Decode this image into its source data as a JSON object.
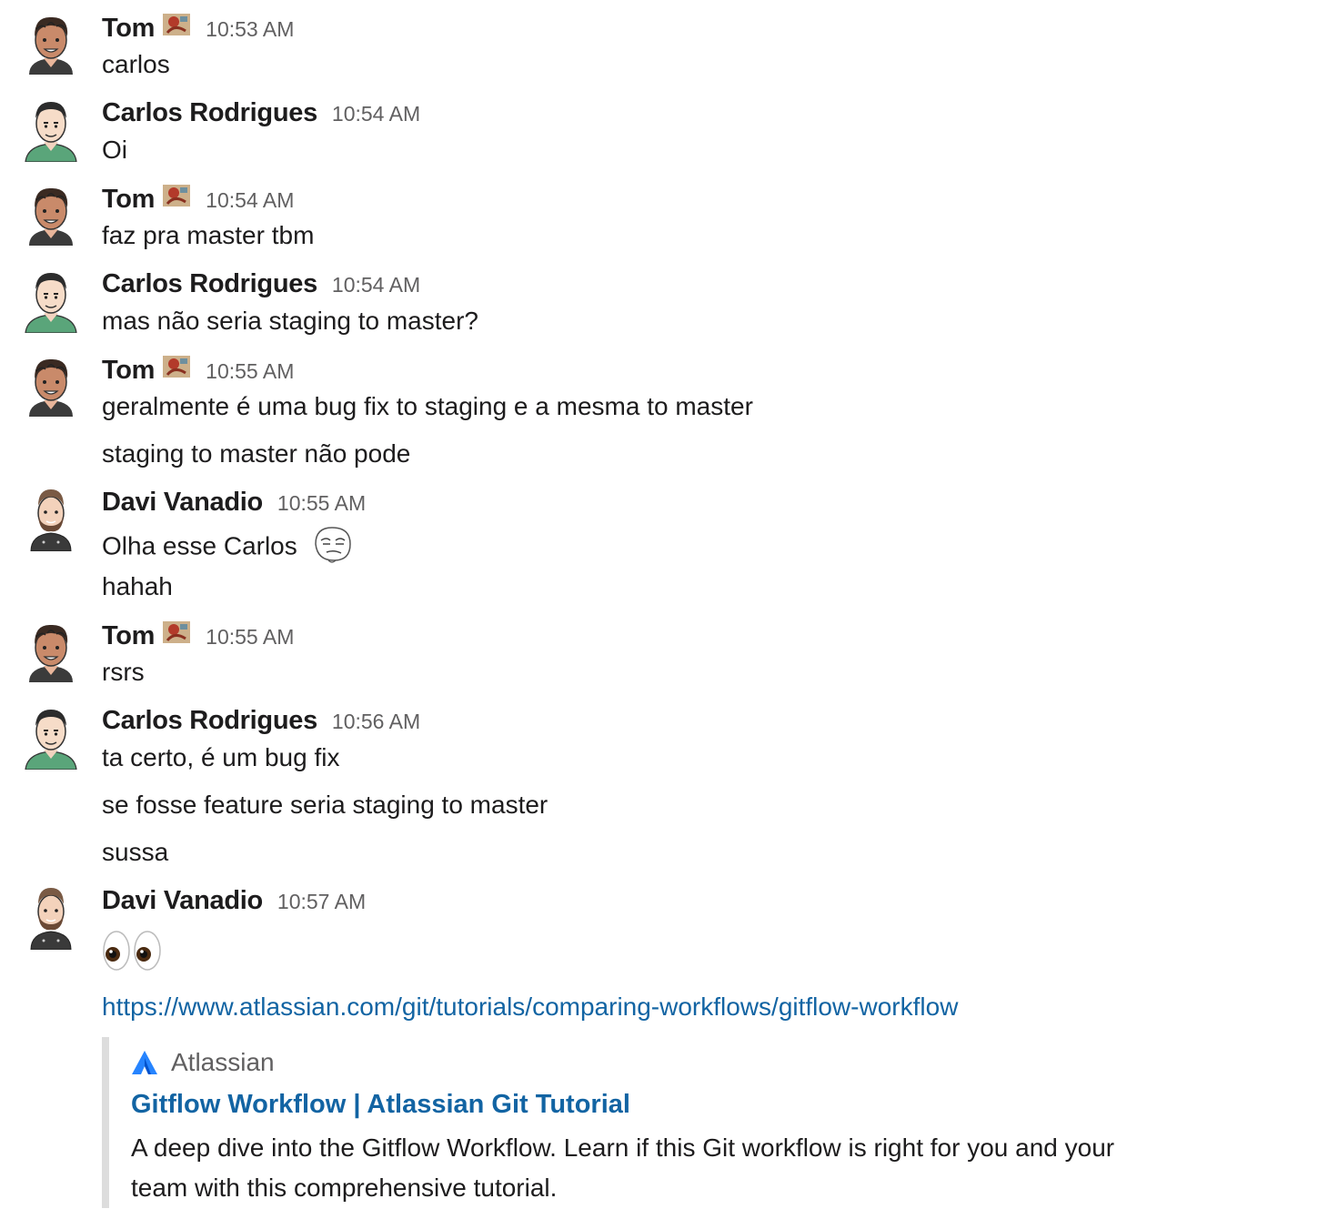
{
  "messages": [
    {
      "author": "Tom",
      "time": "10:53 AM",
      "lines": [
        "carlos"
      ]
    },
    {
      "author": "Carlos Rodrigues",
      "time": "10:54 AM",
      "lines": [
        "Oi"
      ]
    },
    {
      "author": "Tom",
      "time": "10:54 AM",
      "lines": [
        "faz pra master tbm"
      ]
    },
    {
      "author": "Carlos Rodrigues",
      "time": "10:54 AM",
      "lines": [
        "mas não seria staging to master?"
      ]
    },
    {
      "author": "Tom",
      "time": "10:55 AM",
      "lines": [
        "geralmente é uma bug fix to staging e a mesma to master",
        "staging to master não pode"
      ]
    },
    {
      "author": "Davi Vanadio",
      "time": "10:55 AM",
      "lines": [
        "Olha esse Carlos",
        "hahah"
      ]
    },
    {
      "author": "Tom",
      "time": "10:55 AM",
      "lines": [
        "rsrs"
      ]
    },
    {
      "author": "Carlos Rodrigues",
      "time": "10:56 AM",
      "lines": [
        "ta certo, é um bug fix",
        "se fosse feature seria staging to master",
        "sussa"
      ]
    },
    {
      "author": "Davi Vanadio",
      "time": "10:57 AM",
      "lines": [
        "👀"
      ]
    }
  ],
  "link": "https://www.atlassian.com/git/tutorials/comparing-workflows/gitflow-workflow",
  "unfurl": {
    "site": "Atlassian",
    "title": "Gitflow Workflow | Atlassian Git Tutorial",
    "description": "A deep dive into the Gitflow Workflow. Learn if this Git workflow is right for you and your team with this comprehensive tutorial."
  },
  "icons": {
    "tom_badge": "custom-status-emoji",
    "meh_emoji": "meh-face-emoji",
    "site_logo": "atlassian-logo-icon"
  },
  "colors": {
    "link": "#1264a3",
    "timestamp": "#616061",
    "text": "#1d1c1d",
    "attachment_bar": "#dddddd"
  }
}
